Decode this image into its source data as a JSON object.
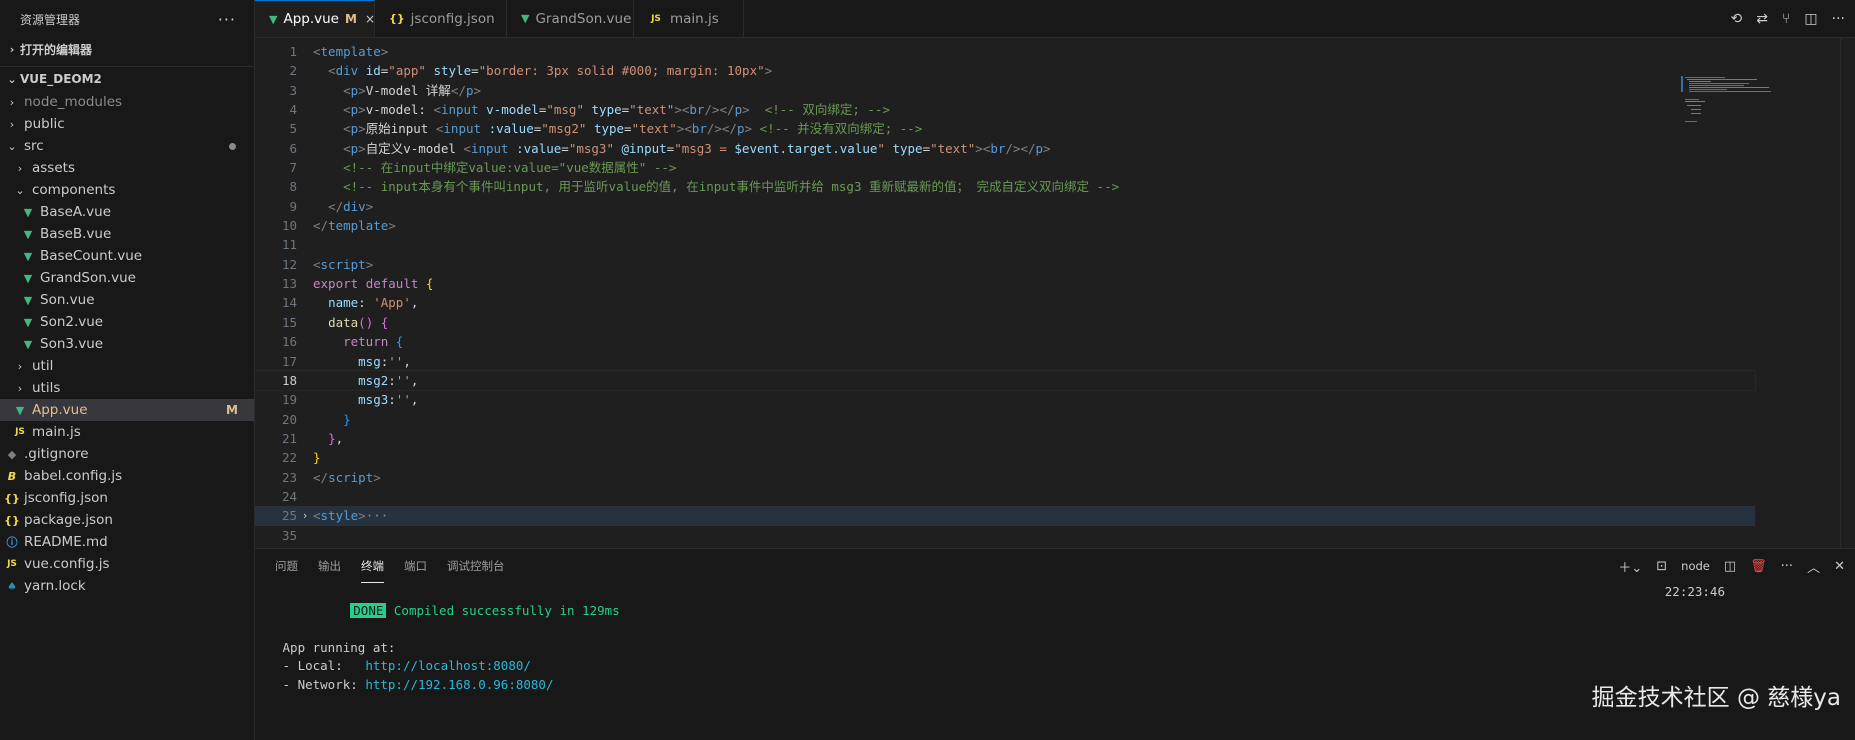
{
  "explorer": {
    "title": "资源管理器",
    "more": "···",
    "open_editors": "打开的编辑器",
    "project": "VUE_DEOM2",
    "tree": [
      {
        "label": "node_modules",
        "kind": "folder",
        "depth": 1,
        "expanded": false,
        "muted": true
      },
      {
        "label": "public",
        "kind": "folder",
        "depth": 1,
        "expanded": false
      },
      {
        "label": "src",
        "kind": "folder",
        "depth": 1,
        "expanded": true,
        "dot": true
      },
      {
        "label": "assets",
        "kind": "folder",
        "depth": 2,
        "expanded": false
      },
      {
        "label": "components",
        "kind": "folder",
        "depth": 2,
        "expanded": true
      },
      {
        "label": "BaseA.vue",
        "kind": "vue",
        "depth": 3
      },
      {
        "label": "BaseB.vue",
        "kind": "vue",
        "depth": 3
      },
      {
        "label": "BaseCount.vue",
        "kind": "vue",
        "depth": 3
      },
      {
        "label": "GrandSon.vue",
        "kind": "vue",
        "depth": 3
      },
      {
        "label": "Son.vue",
        "kind": "vue",
        "depth": 3
      },
      {
        "label": "Son2.vue",
        "kind": "vue",
        "depth": 3
      },
      {
        "label": "Son3.vue",
        "kind": "vue",
        "depth": 3
      },
      {
        "label": "util",
        "kind": "folder",
        "depth": 2,
        "expanded": false
      },
      {
        "label": "utils",
        "kind": "folder",
        "depth": 2,
        "expanded": false
      },
      {
        "label": "App.vue",
        "kind": "vue",
        "depth": 2,
        "active": true,
        "badge": "M"
      },
      {
        "label": "main.js",
        "kind": "js",
        "depth": 2
      },
      {
        "label": ".gitignore",
        "kind": "git",
        "depth": 1
      },
      {
        "label": "babel.config.js",
        "kind": "babel",
        "depth": 1
      },
      {
        "label": "jsconfig.json",
        "kind": "json",
        "depth": 1
      },
      {
        "label": "package.json",
        "kind": "json",
        "depth": 1
      },
      {
        "label": "README.md",
        "kind": "info",
        "depth": 1
      },
      {
        "label": "vue.config.js",
        "kind": "js",
        "depth": 1
      },
      {
        "label": "yarn.lock",
        "kind": "yarn",
        "depth": 1
      }
    ]
  },
  "tabs": [
    {
      "label": "App.vue",
      "kind": "vue",
      "active": true,
      "modified": "M",
      "close": "×"
    },
    {
      "label": "jsconfig.json",
      "kind": "json"
    },
    {
      "label": "GrandSon.vue",
      "kind": "vue"
    },
    {
      "label": "main.js",
      "kind": "js"
    }
  ],
  "icon_glyphs": {
    "vue": "▼",
    "js": "JS",
    "json": "{}",
    "git": "◆",
    "babel": "B",
    "info": "ⓘ",
    "yarn": "♠",
    "folder_closed": "›",
    "folder_open": "⌄"
  },
  "editor": {
    "current_line": "18",
    "lines": [
      {
        "n": "1",
        "tokens": [
          [
            "p",
            "<"
          ],
          [
            "tag",
            "template"
          ],
          [
            "p",
            ">"
          ]
        ]
      },
      {
        "n": "2",
        "tokens": [
          [
            "txt",
            "  "
          ],
          [
            "p",
            "<"
          ],
          [
            "tag",
            "div"
          ],
          [
            "txt",
            " "
          ],
          [
            "attr",
            "id"
          ],
          [
            "txt",
            "="
          ],
          [
            "str",
            "\"app\""
          ],
          [
            "txt",
            " "
          ],
          [
            "attr",
            "style"
          ],
          [
            "txt",
            "="
          ],
          [
            "str",
            "\"border: 3px solid #000; margin: 10px\""
          ],
          [
            "p",
            ">"
          ]
        ]
      },
      {
        "n": "3",
        "tokens": [
          [
            "txt",
            "    "
          ],
          [
            "p",
            "<"
          ],
          [
            "tag",
            "p"
          ],
          [
            "p",
            ">"
          ],
          [
            "txt",
            "V-model 详解"
          ],
          [
            "p",
            "</"
          ],
          [
            "tag",
            "p"
          ],
          [
            "p",
            ">"
          ]
        ]
      },
      {
        "n": "4",
        "tokens": [
          [
            "txt",
            "    "
          ],
          [
            "p",
            "<"
          ],
          [
            "tag",
            "p"
          ],
          [
            "p",
            ">"
          ],
          [
            "txt",
            "v-model: "
          ],
          [
            "p",
            "<"
          ],
          [
            "tag",
            "input"
          ],
          [
            "txt",
            " "
          ],
          [
            "attr",
            "v-model"
          ],
          [
            "txt",
            "="
          ],
          [
            "str",
            "\"msg\""
          ],
          [
            "txt",
            " "
          ],
          [
            "attr",
            "type"
          ],
          [
            "txt",
            "="
          ],
          [
            "str",
            "\"text\""
          ],
          [
            "p",
            ">"
          ],
          [
            "p",
            "<"
          ],
          [
            "tag",
            "br"
          ],
          [
            "p",
            "/></"
          ],
          [
            "tag",
            "p"
          ],
          [
            "p",
            ">"
          ],
          [
            "txt",
            "  "
          ],
          [
            "com",
            "<!-- 双向绑定; -->"
          ]
        ]
      },
      {
        "n": "5",
        "tokens": [
          [
            "txt",
            "    "
          ],
          [
            "p",
            "<"
          ],
          [
            "tag",
            "p"
          ],
          [
            "p",
            ">"
          ],
          [
            "txt",
            "原始input "
          ],
          [
            "p",
            "<"
          ],
          [
            "tag",
            "input"
          ],
          [
            "txt",
            " "
          ],
          [
            "attr",
            ":value"
          ],
          [
            "txt",
            "="
          ],
          [
            "str",
            "\"msg2\""
          ],
          [
            "txt",
            " "
          ],
          [
            "attr",
            "type"
          ],
          [
            "txt",
            "="
          ],
          [
            "str",
            "\"text\""
          ],
          [
            "p",
            ">"
          ],
          [
            "p",
            "<"
          ],
          [
            "tag",
            "br"
          ],
          [
            "p",
            "/></"
          ],
          [
            "tag",
            "p"
          ],
          [
            "p",
            ">"
          ],
          [
            "txt",
            " "
          ],
          [
            "com",
            "<!-- 并没有双向绑定; -->"
          ]
        ]
      },
      {
        "n": "6",
        "tokens": [
          [
            "txt",
            "    "
          ],
          [
            "p",
            "<"
          ],
          [
            "tag",
            "p"
          ],
          [
            "p",
            ">"
          ],
          [
            "txt",
            "自定义v-model "
          ],
          [
            "p",
            "<"
          ],
          [
            "tag",
            "input"
          ],
          [
            "txt",
            " "
          ],
          [
            "attr",
            ":value"
          ],
          [
            "txt",
            "="
          ],
          [
            "str",
            "\"msg3\""
          ],
          [
            "txt",
            " "
          ],
          [
            "attr",
            "@input"
          ],
          [
            "txt",
            "="
          ],
          [
            "str",
            "\"msg3 = "
          ],
          [
            "attr",
            "$event.target.value"
          ],
          [
            "str",
            "\""
          ],
          [
            "txt",
            " "
          ],
          [
            "attr",
            "type"
          ],
          [
            "txt",
            "="
          ],
          [
            "str",
            "\"text\""
          ],
          [
            "p",
            ">"
          ],
          [
            "p",
            "<"
          ],
          [
            "tag",
            "br"
          ],
          [
            "p",
            "/></"
          ],
          [
            "tag",
            "p"
          ],
          [
            "p",
            ">"
          ]
        ]
      },
      {
        "n": "7",
        "tokens": [
          [
            "txt",
            "    "
          ],
          [
            "com",
            "<!-- 在input中绑定value:value=\"vue数据属性\" -->"
          ]
        ]
      },
      {
        "n": "8",
        "tokens": [
          [
            "txt",
            "    "
          ],
          [
            "com",
            "<!-- input本身有个事件叫input, 用于监听value的值, 在input事件中监听并给 msg3 重新赋最新的值； 完成自定义双向绑定 -->"
          ]
        ]
      },
      {
        "n": "9",
        "tokens": [
          [
            "txt",
            "  "
          ],
          [
            "p",
            "</"
          ],
          [
            "tag",
            "div"
          ],
          [
            "p",
            ">"
          ]
        ]
      },
      {
        "n": "10",
        "tokens": [
          [
            "p",
            "</"
          ],
          [
            "tag",
            "template"
          ],
          [
            "p",
            ">"
          ]
        ]
      },
      {
        "n": "11",
        "tokens": []
      },
      {
        "n": "12",
        "tokens": [
          [
            "p",
            "<"
          ],
          [
            "tag",
            "script"
          ],
          [
            "p",
            ">"
          ]
        ]
      },
      {
        "n": "13",
        "tokens": [
          [
            "kw",
            "export"
          ],
          [
            "txt",
            " "
          ],
          [
            "kw",
            "default"
          ],
          [
            "txt",
            " "
          ],
          [
            "b1",
            "{"
          ]
        ]
      },
      {
        "n": "14",
        "tokens": [
          [
            "txt",
            "  "
          ],
          [
            "prop",
            "name"
          ],
          [
            "txt",
            ": "
          ],
          [
            "str",
            "'App'"
          ],
          [
            "txt",
            ","
          ]
        ]
      },
      {
        "n": "15",
        "tokens": [
          [
            "txt",
            "  "
          ],
          [
            "fn",
            "data"
          ],
          [
            "b2",
            "()"
          ],
          [
            "txt",
            " "
          ],
          [
            "b2",
            "{"
          ]
        ]
      },
      {
        "n": "16",
        "tokens": [
          [
            "txt",
            "    "
          ],
          [
            "kw",
            "return"
          ],
          [
            "txt",
            " "
          ],
          [
            "b3",
            "{"
          ]
        ]
      },
      {
        "n": "17",
        "tokens": [
          [
            "txt",
            "      "
          ],
          [
            "prop",
            "msg"
          ],
          [
            "txt",
            ":"
          ],
          [
            "str",
            "''"
          ],
          [
            "txt",
            ","
          ]
        ]
      },
      {
        "n": "18",
        "tokens": [
          [
            "txt",
            "      "
          ],
          [
            "prop",
            "msg2"
          ],
          [
            "txt",
            ":"
          ],
          [
            "str",
            "''"
          ],
          [
            "txt",
            ","
          ]
        ]
      },
      {
        "n": "19",
        "tokens": [
          [
            "txt",
            "      "
          ],
          [
            "prop",
            "msg3"
          ],
          [
            "txt",
            ":"
          ],
          [
            "str",
            "''"
          ],
          [
            "txt",
            ","
          ]
        ]
      },
      {
        "n": "20",
        "tokens": [
          [
            "txt",
            "    "
          ],
          [
            "b3",
            "}"
          ]
        ]
      },
      {
        "n": "21",
        "tokens": [
          [
            "txt",
            "  "
          ],
          [
            "b2",
            "}"
          ],
          [
            "txt",
            ","
          ]
        ]
      },
      {
        "n": "22",
        "tokens": [
          [
            "b1",
            "}"
          ]
        ]
      },
      {
        "n": "23",
        "tokens": [
          [
            "p",
            "</"
          ],
          [
            "tag",
            "script"
          ],
          [
            "p",
            ">"
          ]
        ]
      },
      {
        "n": "24",
        "tokens": []
      },
      {
        "n": "25",
        "tokens": [
          [
            "p",
            "<"
          ],
          [
            "tag",
            "style"
          ],
          [
            "p",
            ">"
          ],
          [
            "ell",
            "···"
          ]
        ],
        "folded": true
      },
      {
        "n": "35",
        "tokens": []
      }
    ]
  },
  "panel": {
    "tabs": [
      "问题",
      "输出",
      "终端",
      "端口",
      "调试控制台"
    ],
    "active_tab": "终端",
    "shell_label": "node",
    "terminal": {
      "done_badge": "DONE",
      "compiled": "Compiled successfully in 129ms",
      "time": "22:23:46",
      "running": "App running at:",
      "local_label": "- Local:   ",
      "local_url": "http://localhost:8080/",
      "network_label": "- Network: ",
      "network_url": "http://192.168.0.96:8080/"
    }
  },
  "watermark": "掘金技术社区 @ 慈様ya"
}
